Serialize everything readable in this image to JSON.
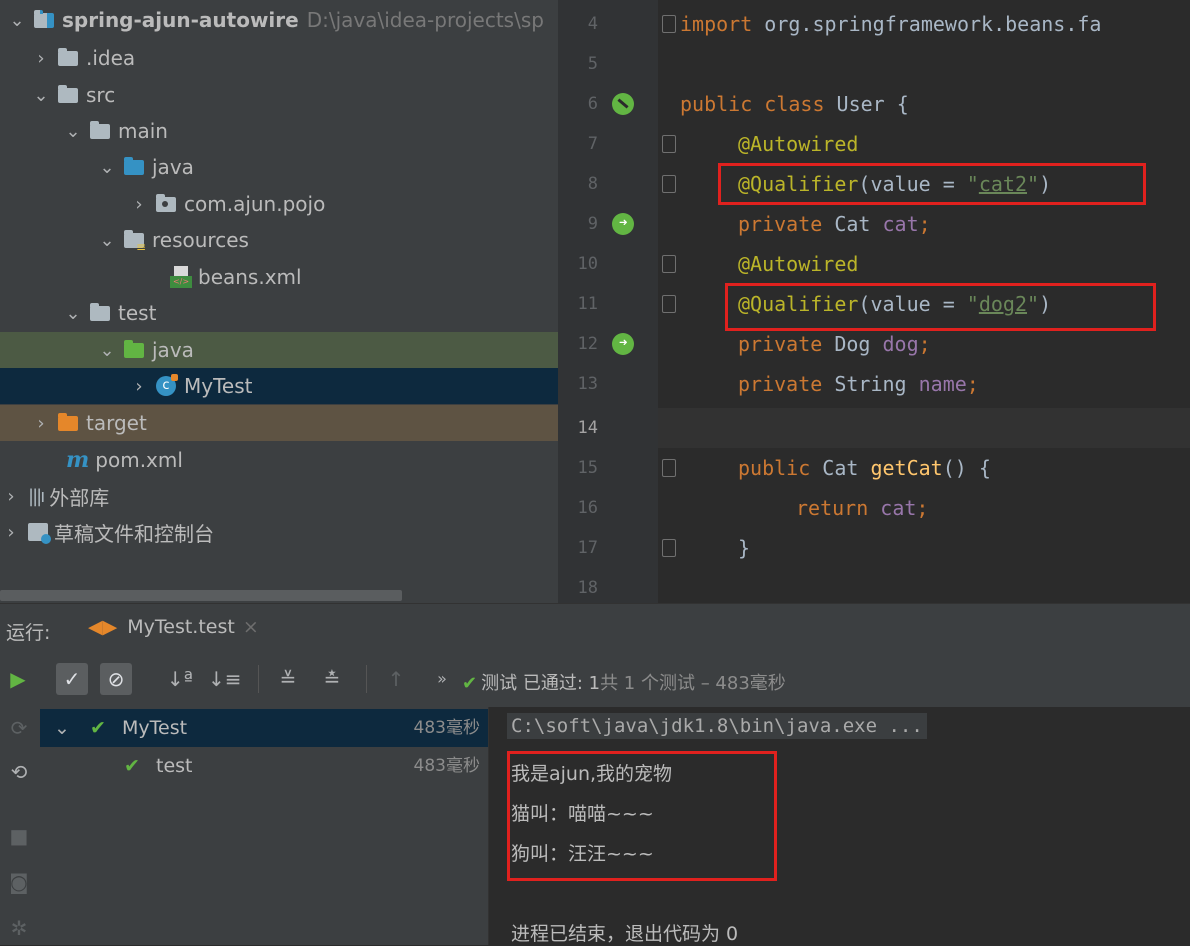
{
  "project_tree": {
    "root": {
      "name": "spring-ajun-autowire",
      "path": "D:\\java\\idea-projects\\sp"
    },
    "items": [
      {
        "label": ".idea"
      },
      {
        "label": "src"
      },
      {
        "label": "main"
      },
      {
        "label": "java"
      },
      {
        "label": "com.ajun.pojo"
      },
      {
        "label": "resources"
      },
      {
        "label": "beans.xml"
      },
      {
        "label": "test"
      },
      {
        "label": "java"
      },
      {
        "label": "MyTest"
      },
      {
        "label": "target"
      },
      {
        "label": "pom.xml"
      },
      {
        "label": "外部库"
      },
      {
        "label": "草稿文件和控制台"
      }
    ]
  },
  "editor": {
    "line_numbers": [
      "4",
      "5",
      "6",
      "7",
      "8",
      "9",
      "10",
      "11",
      "12",
      "13",
      "14",
      "15",
      "16",
      "17",
      "18"
    ],
    "code": {
      "l4_kw": "import",
      "l4_rest": " org.springframework.beans.fa",
      "l6_kw": "public class",
      "l6_rest": " User {",
      "autowired": "@Autowired",
      "qualifier": "@Qualifier",
      "value_eq": "(value = ",
      "quote": "\"",
      "cat2": "cat2",
      "dog2": "dog2",
      "close": ")",
      "private": "private",
      "cat_type": " Cat ",
      "cat_field": "cat",
      "dog_type": " Dog ",
      "dog_field": "dog",
      "string_type": " String ",
      "name_field": "name",
      "semicolon": ";",
      "public": "public",
      "get_cat_fn": "getCat",
      "paren_brace": "() {",
      "return": "return",
      "return_field": " cat",
      "brace_close": "}"
    }
  },
  "run_panel": {
    "label": "运行:",
    "tab": "MyTest.test",
    "status_prefix": "测试 已通过:",
    "status_count": "1",
    "status_rest": "共 1 个测试 – 483毫秒",
    "tests": [
      {
        "name": "MyTest",
        "time": "483毫秒"
      },
      {
        "name": "test",
        "time": "483毫秒"
      }
    ],
    "console": {
      "command": "C:\\soft\\java\\jdk1.8\\bin\\java.exe ...",
      "lines": [
        "我是ajun,我的宠物",
        "猫叫：喵喵~~~",
        "狗叫：汪汪~~~"
      ],
      "exit": "进程已结束，退出代码为 0"
    }
  }
}
